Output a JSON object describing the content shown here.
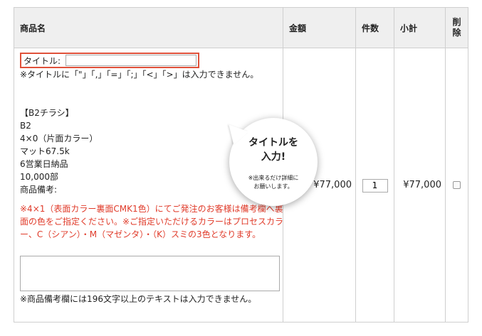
{
  "headers": {
    "product_name": "商品名",
    "amount": "金額",
    "count": "件数",
    "subtotal": "小計",
    "delete_line1": "削",
    "delete_line2": "除"
  },
  "item": {
    "title_label": "タイトル:",
    "title_value": "",
    "title_note": "※タイトルに「\"」「,」「=」「;」「<」「>」は入力できません。",
    "spec_lines": [
      "【B2チラシ】",
      "B2",
      "4×0（片面カラー）",
      "マット67.5k",
      "6営業日納品",
      "10,000部",
      "商品備考:"
    ],
    "red_notes": "※4×1（表面カラー裏面CMK1色）にてご発注のお客様は備考欄へ裏面の色をご指定ください。※ご指定いただけるカラーはプロセスカラー、C（シアン）・M（マゼンタ）・（K）スミの3色となります。",
    "memo_value": "",
    "memo_note": "※商品備考欄には196文字以上のテキストは入力できません。",
    "price": "¥77,000",
    "quantity": "1",
    "subtotal": "¥77,000"
  },
  "callout": {
    "main_line1": "タイトルを",
    "main_line2": "入力!",
    "sub_line1": "※出来るだけ詳細に",
    "sub_line2": "お願いします。"
  },
  "colors": {
    "highlight_border": "#e0513a",
    "note_red": "#e03b2a",
    "header_bg": "#efefef"
  }
}
